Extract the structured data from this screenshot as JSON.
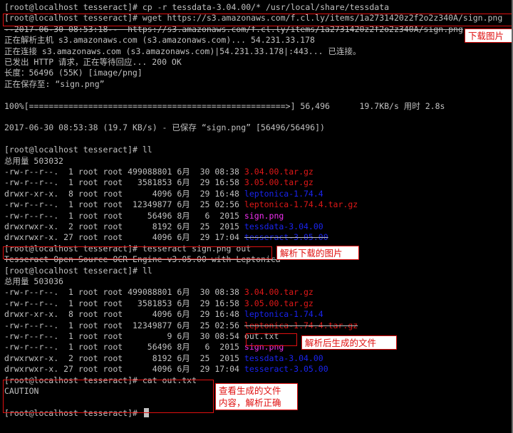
{
  "terminal": {
    "lines": [
      [
        {
          "t": "[root@localhost tesseract]# cp -r tessdata-3.04.00/* /usr/local/share/tessdata"
        }
      ],
      [
        {
          "t": "[root@localhost tesseract]# wget https://s3.amazonaws.com/f.cl.ly/items/1a2731420z2f2o2z340A/sign.png"
        }
      ],
      [
        {
          "t": "--2017-06-30 08:53:18--  https://s3.amazonaws.com/f.cl.ly/items/1a2731420z2f2o2z340A/sign.png",
          "s": 1
        }
      ],
      [
        {
          "t": "正在解析主机 s3.amazonaws.com (s3.amazonaws.com)... 54.231.33.178"
        }
      ],
      [
        {
          "t": "正在连接 s3.amazonaws.com (s3.amazonaws.com)|54.231.33.178|:443... 已连接。"
        }
      ],
      [
        {
          "t": "已发出 HTTP 请求，正在等待回应... 200 OK"
        }
      ],
      [
        {
          "t": "长度：56496 (55K) [image/png]"
        }
      ],
      [
        {
          "t": "正在保存至: “sign.png”"
        }
      ],
      [],
      [
        {
          "t": "100%[====================================================>] 56,496      19.7KB/s 用时 2.8s"
        }
      ],
      [],
      [
        {
          "t": "2017-06-30 08:53:38 (19.7 KB/s) - 已保存 “sign.png” [56496/56496])"
        }
      ],
      [],
      [
        {
          "t": "[root@localhost tesseract]# ll"
        }
      ],
      [
        {
          "t": "总用量 503032"
        }
      ],
      [
        {
          "t": "-rw-r--r--.  1 root root 499088801 6月  30 08:38 "
        },
        {
          "t": "3.04.00.tar.gz",
          "c": "red"
        }
      ],
      [
        {
          "t": "-rw-r--r--.  1 root root   3581853 6月  29 16:58 "
        },
        {
          "t": "3.05.00.tar.gz",
          "c": "red"
        }
      ],
      [
        {
          "t": "drwxr-xr-x.  8 root root      4096 6月  29 16:48 "
        },
        {
          "t": "leptonica-1.74.4",
          "c": "blue"
        }
      ],
      [
        {
          "t": "-rw-r--r--.  1 root root  12349877 6月  25 02:56 "
        },
        {
          "t": "leptonica-1.74.4.tar.gz",
          "c": "red"
        }
      ],
      [
        {
          "t": "-rw-r--r--.  1 root root     56496 8月   6  2015 "
        },
        {
          "t": "sign.png",
          "c": "magenta"
        }
      ],
      [
        {
          "t": "drwxrwxr-x.  2 root root      8192 6月  25  2015 "
        },
        {
          "t": "tessdata-3.04.00",
          "c": "blue"
        }
      ],
      [
        {
          "t": "drwxrwxr-x. 27 root root      4096 6月  29 17:04 "
        },
        {
          "t": "tesseract-3.05.00",
          "c": "blue",
          "s": 1
        }
      ],
      [
        {
          "t": "[root@localhost tesseract]# tesseract sign.png out"
        }
      ],
      [
        {
          "t": "Tesseract Open Source OCR Engine v3.05.00 with Leptonica",
          "s": 1
        }
      ],
      [
        {
          "t": "[root@localhost tesseract]# ll"
        }
      ],
      [
        {
          "t": "总用量 503036"
        }
      ],
      [
        {
          "t": "-rw-r--r--.  1 root root 499088801 6月  30 08:38 "
        },
        {
          "t": "3.04.00.tar.gz",
          "c": "red"
        }
      ],
      [
        {
          "t": "-rw-r--r--.  1 root root   3581853 6月  29 16:58 "
        },
        {
          "t": "3.05.00.tar.gz",
          "c": "red"
        }
      ],
      [
        {
          "t": "drwxr-xr-x.  8 root root      4096 6月  29 16:48 "
        },
        {
          "t": "leptonica-1.74.4",
          "c": "blue"
        }
      ],
      [
        {
          "t": "-rw-r--r--.  1 root root  12349877 6月  25 02:56 "
        },
        {
          "t": "leptonica-1.74.4.tar.gz",
          "c": "red",
          "s": 1
        }
      ],
      [
        {
          "t": "-rw-r--r--.  1 root root         9 6月  30 08:54 out.txt"
        }
      ],
      [
        {
          "t": "-rw-r--r--.  1 root root     56496 8月   6  2015 "
        },
        {
          "t": "sign.png",
          "c": "magenta"
        }
      ],
      [
        {
          "t": "drwxrwxr-x.  2 root root      8192 6月  25  2015 "
        },
        {
          "t": "tessdata-3.04.00",
          "c": "blue"
        }
      ],
      [
        {
          "t": "drwxrwxr-x. 27 root root      4096 6月  29 17:04 "
        },
        {
          "t": "tesseract-3.05.00",
          "c": "blue"
        }
      ],
      [
        {
          "t": "[root@localhost tesseract]# cat out.txt"
        }
      ],
      [
        {
          "t": "CAUTION"
        }
      ],
      [],
      [
        {
          "t": "[root@localhost tesseract]# "
        },
        {
          "cursor": true
        }
      ]
    ]
  },
  "annotations": {
    "download": "下载图片",
    "parse": "解析下载的图片",
    "generated": "解析后生成的文件",
    "view": "查看生成的文件\n内容，解析正确"
  },
  "colors": {
    "background": "#000000",
    "text": "#c0c0c0",
    "archive_red": "#e01818",
    "directory_blue": "#1a24f0",
    "image_magenta": "#f030f0",
    "annotation_red": "#e01010"
  }
}
